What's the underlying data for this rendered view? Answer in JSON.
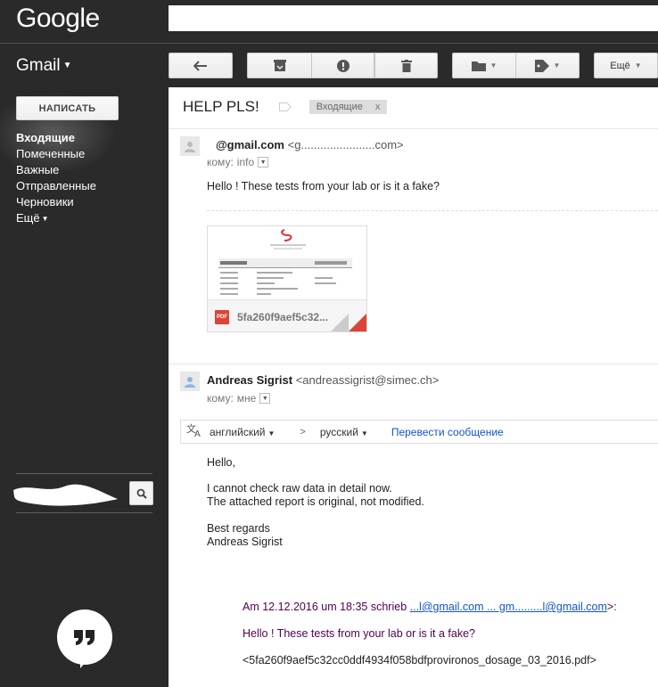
{
  "header": {
    "logo": "Google",
    "app_menu": "Gmail"
  },
  "toolbar": {
    "more_label": "Ещё"
  },
  "sidebar": {
    "compose_label": "НАПИСАТЬ",
    "items": [
      {
        "label": "Входящие",
        "active": true
      },
      {
        "label": "Помеченные"
      },
      {
        "label": "Важные"
      },
      {
        "label": "Отправленные"
      },
      {
        "label": "Черновики"
      },
      {
        "label": "Ещё"
      }
    ]
  },
  "thread": {
    "subject": "HELP PLS!",
    "label": "Входящие",
    "label_remove": "x"
  },
  "message1": {
    "sender_name": "@gmail.com",
    "sender_addr": "<g.......................com>",
    "to_prefix": "кому:",
    "to_name": "info",
    "body": "Hello ! These tests from your lab or is it a fake?",
    "attachment_name": "5fa260f9aef5c32...",
    "attachment_type": "PDF"
  },
  "message2": {
    "sender_name": "Andreas Sigrist",
    "sender_addr": "<andreassigrist@simec.ch>",
    "to_prefix": "кому:",
    "to_name": "мне",
    "greeting": "Hello,",
    "line1": "I cannot check raw data in detail now.",
    "line2": "The attached report is original, not modified.",
    "sign1": "Best regards",
    "sign2": "Andreas Sigrist",
    "quote_prefix": "Am 12.12.2016 um 18:35 schrieb",
    "quote_link": "...l@gmail.com ... gm.........l@gmail.com",
    "quote_suffix": ">:",
    "quote_body": "Hello ! These tests from your lab or is it a fake?",
    "quote_file": "<5fa260f9aef5c32cc0ddf4934f058bdfprovironos_dosage_03_2016.pdf>"
  },
  "translate": {
    "from_lang": "английский",
    "arrow": ">",
    "to_lang": "русский",
    "action": "Перевести сообщение"
  },
  "colors": {
    "link": "#1155cc",
    "quote": "#500050",
    "pdf_red": "#db4437"
  }
}
